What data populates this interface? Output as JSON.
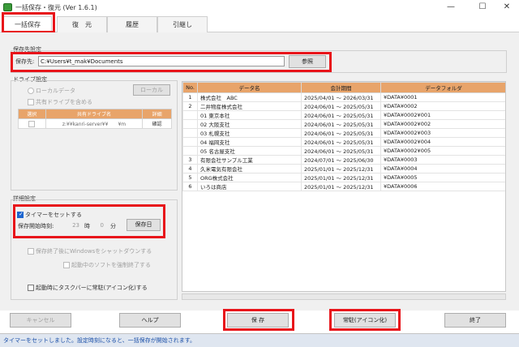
{
  "window": {
    "title": "一括保存・復元 (Ver 1.6.1)",
    "minimize": "—",
    "maximize": "☐",
    "close": "✕"
  },
  "tabs": [
    "一括保存",
    "復　元",
    "履歴",
    "引継し"
  ],
  "save_dest": {
    "group_label": "保存先設定",
    "label": "保存先:",
    "path": "C:¥Users¥t_mak¥Documents",
    "browse_label": "参照"
  },
  "drive": {
    "group_label": "ドライブ設定",
    "local_label": "ローカルデータ",
    "local_button": "ローカル",
    "shared_label": "共有ドライブを含める",
    "columns": [
      "選択",
      "共有ドライブ名",
      "詳細"
    ],
    "rows": [
      {
        "name": "z:¥¥kanri-server¥¥　　¥m",
        "detail": "確認"
      }
    ]
  },
  "detail": {
    "group_label": "詳細設定",
    "timer_label": "タイマーをセットする",
    "timer_checked": true,
    "start_time_label": "保存開始時刻:",
    "hour_value": "23",
    "hour_unit": "時",
    "minute_value": "0",
    "minute_unit": "分",
    "save_day_button": "保存日",
    "shutdown_label": "保存終了後にWindowsをシャットダウンする",
    "force_close_label": "起動中のソフトを強制終了する",
    "startup_label": "起動時にタスクバーに常駐(アイコン化)する"
  },
  "data_table": {
    "columns": [
      "No.",
      "データ名",
      "会計期間",
      "データフォルダ"
    ],
    "rows": [
      {
        "no": "1",
        "name": "株式会社　ABC",
        "period": "2025/04/01 ～ 2026/03/31",
        "folder": "¥DATA¥0001"
      },
      {
        "no": "2",
        "name": "二井物産株式会社",
        "period": "2024/06/01 ～ 2025/05/31",
        "folder": "¥DATA¥0002"
      },
      {
        "no": "",
        "name": "01 東京本社",
        "period": "2024/06/01 ～ 2025/05/31",
        "folder": "¥DATA¥0002¥001"
      },
      {
        "no": "",
        "name": "02 大阪支社",
        "period": "2024/06/01 ～ 2025/05/31",
        "folder": "¥DATA¥0002¥002"
      },
      {
        "no": "",
        "name": "03 札幌支社",
        "period": "2024/06/01 ～ 2025/05/31",
        "folder": "¥DATA¥0002¥003"
      },
      {
        "no": "",
        "name": "04 福岡支社",
        "period": "2024/06/01 ～ 2025/05/31",
        "folder": "¥DATA¥0002¥004"
      },
      {
        "no": "",
        "name": "05 名古屋支社",
        "period": "2024/06/01 ～ 2025/05/31",
        "folder": "¥DATA¥0002¥005"
      },
      {
        "no": "3",
        "name": "有限会社サンプル工業",
        "period": "2024/07/01 ～ 2025/06/30",
        "folder": "¥DATA¥0003"
      },
      {
        "no": "4",
        "name": "久米電気有限会社",
        "period": "2025/01/01 ～ 2025/12/31",
        "folder": "¥DATA¥0004"
      },
      {
        "no": "5",
        "name": "ORG株式会社",
        "period": "2025/01/01 ～ 2025/12/31",
        "folder": "¥DATA¥0005"
      },
      {
        "no": "6",
        "name": "いろは商店",
        "period": "2025/01/01 ～ 2025/12/31",
        "folder": "¥DATA¥0006"
      }
    ]
  },
  "buttons": {
    "cancel": "キャンセル",
    "help": "ヘルプ",
    "save": "保 存",
    "resident": "常駐(アイコン化)",
    "exit": "終了"
  },
  "status": "タイマーをセットしました。設定時刻になると、一括保存が開始されます。",
  "colors": {
    "highlight": "#e8141a",
    "table_header": "#e8a46a",
    "status_text": "#1a4fa8"
  }
}
